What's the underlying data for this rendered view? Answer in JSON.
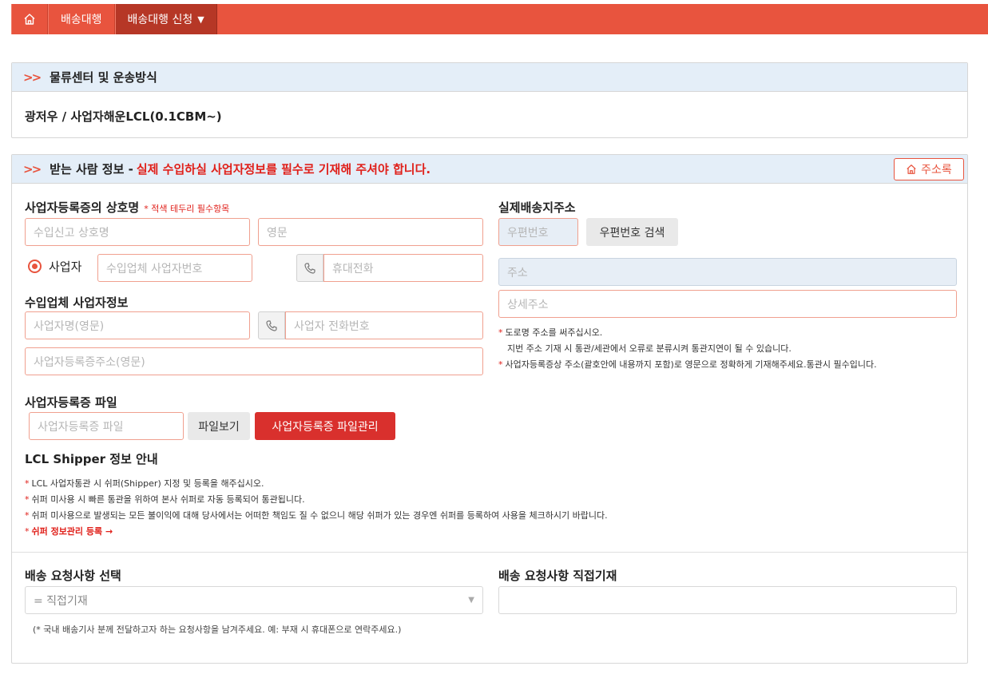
{
  "nav": {
    "home_icon": "home-icon",
    "items": [
      {
        "label": "배송대행"
      },
      {
        "label": "배송대행 신청",
        "caret": "▼"
      }
    ]
  },
  "section1": {
    "title": "물류센터 및 운송방식",
    "value": "광저우 / 사업자해운LCL(0.1CBM~)"
  },
  "section2": {
    "title": "받는 사람 정보 - ",
    "warning": "실제 수입하실 사업자정보를 필수로 기재해 주셔야 합니다.",
    "address_book_button": "주소록",
    "company_name": {
      "label": "사업자등록증의 상호명",
      "required_note": "* 적색 테두리 필수항목",
      "placeholder_customs": "수입신고 상호명",
      "placeholder_english": "영문"
    },
    "business": {
      "radio_label": "사업자",
      "placeholder_bizno": "수입업체 사업자번호",
      "placeholder_mobile": "휴대전화"
    },
    "importer": {
      "label": "수입업체 사업자정보",
      "placeholder_name_en": "사업자명(영문)",
      "placeholder_phone": "사업자 전화번호",
      "placeholder_address_en": "사업자등록증주소(영문)"
    },
    "file": {
      "label": "사업자등록증 파일",
      "placeholder": "사업자등록증 파일",
      "view_button": "파일보기",
      "manage_button": "사업자등록증 파일관리"
    },
    "shipper": {
      "title": "LCL Shipper 정보 안내",
      "notes": [
        "LCL 사업자통관 시 쉬퍼(Shipper) 지정 및 등록을 해주십시오.",
        "쉬퍼 미사용 시 빠른 통관을 위하여 본사 쉬퍼로 자동 등록되어 통관됩니다.",
        "쉬퍼 미사용으로 발생되는 모든 불이익에 대해 당사에서는 어떠한 책임도 질 수 없으니 해당 쉬퍼가 있는 경우엔 쉬퍼를 등록하여 사용을 체크하시기 바랍니다."
      ],
      "link": "쉬퍼 정보관리 등록 →"
    },
    "delivery_address": {
      "label": "실제배송지주소",
      "placeholder_zip": "우편번호",
      "zip_search_button": "우편번호 검색",
      "placeholder_address": "주소",
      "placeholder_detail": "상세주소",
      "notes": [
        "도로명 주소를 써주십시오.",
        "지번 주소 기재 시 통관/세관에서 오류로 분류시켜 통관지연이 될 수 있습니다.",
        "사업자등록증상 주소(괄호안에 내용까지 포함)로 영문으로 정확하게 기재해주세요.통관시 필수입니다."
      ]
    },
    "request": {
      "select_label": "배송 요청사항 선택",
      "select_value": "= 직접기재",
      "direct_label": "배송 요청사항 직접기재",
      "hint": "(* 국내 배송기사 분께 전달하고자 하는 요청사항을 남겨주세요. 예: 부재 시 휴대폰으로 연락주세요.)"
    }
  },
  "colors": {
    "brand": "#e8543e",
    "brand_dark": "#b63726",
    "warning": "#e0201a",
    "header_bg": "#e4eef8",
    "manage_button": "#d9302d"
  }
}
